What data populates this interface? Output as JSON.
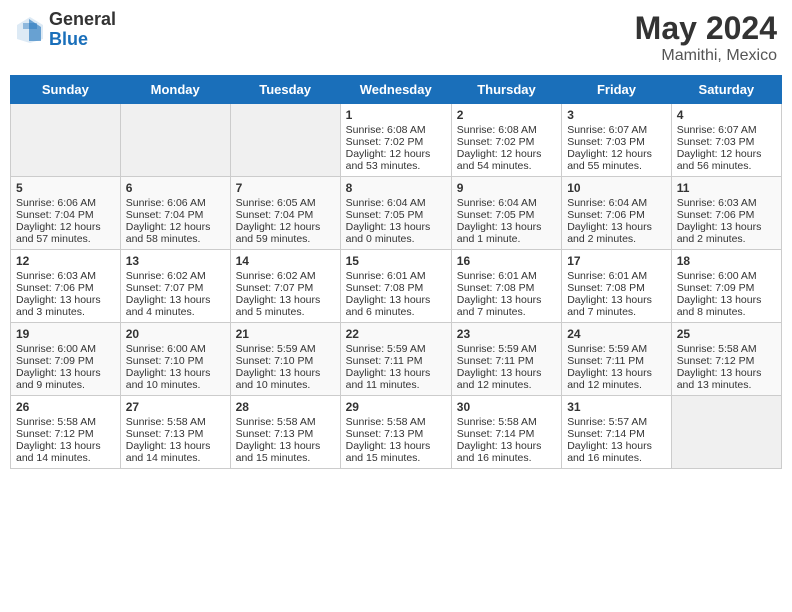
{
  "header": {
    "logo_general": "General",
    "logo_blue": "Blue",
    "month": "May 2024",
    "location": "Mamithi, Mexico"
  },
  "days_of_week": [
    "Sunday",
    "Monday",
    "Tuesday",
    "Wednesday",
    "Thursday",
    "Friday",
    "Saturday"
  ],
  "weeks": [
    [
      {
        "day": "",
        "sunrise": "",
        "sunset": "",
        "daylight": "",
        "empty": true
      },
      {
        "day": "",
        "sunrise": "",
        "sunset": "",
        "daylight": "",
        "empty": true
      },
      {
        "day": "",
        "sunrise": "",
        "sunset": "",
        "daylight": "",
        "empty": true
      },
      {
        "day": "1",
        "sunrise": "Sunrise: 6:08 AM",
        "sunset": "Sunset: 7:02 PM",
        "daylight": "Daylight: 12 hours and 53 minutes."
      },
      {
        "day": "2",
        "sunrise": "Sunrise: 6:08 AM",
        "sunset": "Sunset: 7:02 PM",
        "daylight": "Daylight: 12 hours and 54 minutes."
      },
      {
        "day": "3",
        "sunrise": "Sunrise: 6:07 AM",
        "sunset": "Sunset: 7:03 PM",
        "daylight": "Daylight: 12 hours and 55 minutes."
      },
      {
        "day": "4",
        "sunrise": "Sunrise: 6:07 AM",
        "sunset": "Sunset: 7:03 PM",
        "daylight": "Daylight: 12 hours and 56 minutes."
      }
    ],
    [
      {
        "day": "5",
        "sunrise": "Sunrise: 6:06 AM",
        "sunset": "Sunset: 7:04 PM",
        "daylight": "Daylight: 12 hours and 57 minutes."
      },
      {
        "day": "6",
        "sunrise": "Sunrise: 6:06 AM",
        "sunset": "Sunset: 7:04 PM",
        "daylight": "Daylight: 12 hours and 58 minutes."
      },
      {
        "day": "7",
        "sunrise": "Sunrise: 6:05 AM",
        "sunset": "Sunset: 7:04 PM",
        "daylight": "Daylight: 12 hours and 59 minutes."
      },
      {
        "day": "8",
        "sunrise": "Sunrise: 6:04 AM",
        "sunset": "Sunset: 7:05 PM",
        "daylight": "Daylight: 13 hours and 0 minutes."
      },
      {
        "day": "9",
        "sunrise": "Sunrise: 6:04 AM",
        "sunset": "Sunset: 7:05 PM",
        "daylight": "Daylight: 13 hours and 1 minute."
      },
      {
        "day": "10",
        "sunrise": "Sunrise: 6:04 AM",
        "sunset": "Sunset: 7:06 PM",
        "daylight": "Daylight: 13 hours and 2 minutes."
      },
      {
        "day": "11",
        "sunrise": "Sunrise: 6:03 AM",
        "sunset": "Sunset: 7:06 PM",
        "daylight": "Daylight: 13 hours and 2 minutes."
      }
    ],
    [
      {
        "day": "12",
        "sunrise": "Sunrise: 6:03 AM",
        "sunset": "Sunset: 7:06 PM",
        "daylight": "Daylight: 13 hours and 3 minutes."
      },
      {
        "day": "13",
        "sunrise": "Sunrise: 6:02 AM",
        "sunset": "Sunset: 7:07 PM",
        "daylight": "Daylight: 13 hours and 4 minutes."
      },
      {
        "day": "14",
        "sunrise": "Sunrise: 6:02 AM",
        "sunset": "Sunset: 7:07 PM",
        "daylight": "Daylight: 13 hours and 5 minutes."
      },
      {
        "day": "15",
        "sunrise": "Sunrise: 6:01 AM",
        "sunset": "Sunset: 7:08 PM",
        "daylight": "Daylight: 13 hours and 6 minutes."
      },
      {
        "day": "16",
        "sunrise": "Sunrise: 6:01 AM",
        "sunset": "Sunset: 7:08 PM",
        "daylight": "Daylight: 13 hours and 7 minutes."
      },
      {
        "day": "17",
        "sunrise": "Sunrise: 6:01 AM",
        "sunset": "Sunset: 7:08 PM",
        "daylight": "Daylight: 13 hours and 7 minutes."
      },
      {
        "day": "18",
        "sunrise": "Sunrise: 6:00 AM",
        "sunset": "Sunset: 7:09 PM",
        "daylight": "Daylight: 13 hours and 8 minutes."
      }
    ],
    [
      {
        "day": "19",
        "sunrise": "Sunrise: 6:00 AM",
        "sunset": "Sunset: 7:09 PM",
        "daylight": "Daylight: 13 hours and 9 minutes."
      },
      {
        "day": "20",
        "sunrise": "Sunrise: 6:00 AM",
        "sunset": "Sunset: 7:10 PM",
        "daylight": "Daylight: 13 hours and 10 minutes."
      },
      {
        "day": "21",
        "sunrise": "Sunrise: 5:59 AM",
        "sunset": "Sunset: 7:10 PM",
        "daylight": "Daylight: 13 hours and 10 minutes."
      },
      {
        "day": "22",
        "sunrise": "Sunrise: 5:59 AM",
        "sunset": "Sunset: 7:11 PM",
        "daylight": "Daylight: 13 hours and 11 minutes."
      },
      {
        "day": "23",
        "sunrise": "Sunrise: 5:59 AM",
        "sunset": "Sunset: 7:11 PM",
        "daylight": "Daylight: 13 hours and 12 minutes."
      },
      {
        "day": "24",
        "sunrise": "Sunrise: 5:59 AM",
        "sunset": "Sunset: 7:11 PM",
        "daylight": "Daylight: 13 hours and 12 minutes."
      },
      {
        "day": "25",
        "sunrise": "Sunrise: 5:58 AM",
        "sunset": "Sunset: 7:12 PM",
        "daylight": "Daylight: 13 hours and 13 minutes."
      }
    ],
    [
      {
        "day": "26",
        "sunrise": "Sunrise: 5:58 AM",
        "sunset": "Sunset: 7:12 PM",
        "daylight": "Daylight: 13 hours and 14 minutes."
      },
      {
        "day": "27",
        "sunrise": "Sunrise: 5:58 AM",
        "sunset": "Sunset: 7:13 PM",
        "daylight": "Daylight: 13 hours and 14 minutes."
      },
      {
        "day": "28",
        "sunrise": "Sunrise: 5:58 AM",
        "sunset": "Sunset: 7:13 PM",
        "daylight": "Daylight: 13 hours and 15 minutes."
      },
      {
        "day": "29",
        "sunrise": "Sunrise: 5:58 AM",
        "sunset": "Sunset: 7:13 PM",
        "daylight": "Daylight: 13 hours and 15 minutes."
      },
      {
        "day": "30",
        "sunrise": "Sunrise: 5:58 AM",
        "sunset": "Sunset: 7:14 PM",
        "daylight": "Daylight: 13 hours and 16 minutes."
      },
      {
        "day": "31",
        "sunrise": "Sunrise: 5:57 AM",
        "sunset": "Sunset: 7:14 PM",
        "daylight": "Daylight: 13 hours and 16 minutes."
      },
      {
        "day": "",
        "sunrise": "",
        "sunset": "",
        "daylight": "",
        "empty": true
      }
    ]
  ]
}
